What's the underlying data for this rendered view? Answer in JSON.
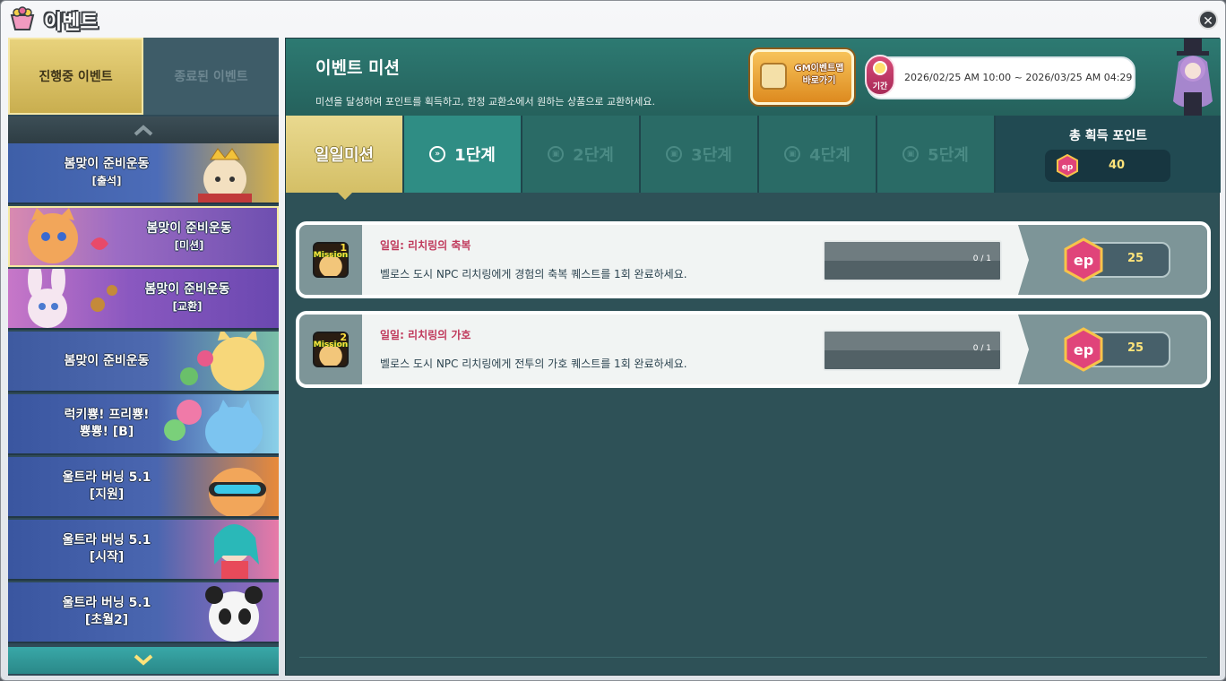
{
  "window": {
    "title": "이벤트",
    "close_label": "✕"
  },
  "sidebar": {
    "tabs": {
      "ongoing": "진행중 이벤트",
      "ended": "종료된 이벤트"
    },
    "items": [
      {
        "title": "봄맞이 준비운동",
        "sub": "[출석]"
      },
      {
        "title": "봄맞이 준비운동",
        "sub": "[미션]",
        "selected": true
      },
      {
        "title": "봄맞이 준비운동",
        "sub": "[교환]"
      },
      {
        "title": "봄맞이 준비운동",
        "sub": ""
      },
      {
        "title": "럭키뿅! 프리뿅!",
        "sub": "뿅뿅! [B]"
      },
      {
        "title": "울트라 버닝 5.1",
        "sub": "[지원]"
      },
      {
        "title": "울트라 버닝 5.1",
        "sub": "[시작]"
      },
      {
        "title": "울트라 버닝 5.1",
        "sub": "[초월2]"
      }
    ]
  },
  "header": {
    "title": "이벤트 미션",
    "description": "미션을 달성하여 포인트를 획득하고, 한정 교환소에서 원하는 상품으로 교환하세요.",
    "gm_button": {
      "line1": "GM이벤트맵",
      "line2": "바로가기"
    },
    "period": {
      "label": "기간",
      "text": "2026/02/25 AM 10:00 ~ 2026/03/25 AM 04:29"
    }
  },
  "stages": {
    "daily": "일일미션",
    "tabs": [
      "1단계",
      "2단계",
      "3단계",
      "4단계",
      "5단계"
    ],
    "active_index": 0
  },
  "points": {
    "title": "총 획득 포인트",
    "value": "40",
    "icon": "ep-coin-icon"
  },
  "missions": [
    {
      "badge": "Mission",
      "badge_num": "1",
      "title": "일일: 리치링의 축복",
      "description": "벨로스 도시 NPC 리치링에게 경험의 축복 퀘스트를 1회 완료하세요.",
      "progress_text": "0 / 1",
      "progress": 0,
      "reward_icon": "ep",
      "reward": "25"
    },
    {
      "badge": "Mission",
      "badge_num": "2",
      "title": "일일: 리치링의 가호",
      "description": "벨로스 도시 NPC 리치링에게 전투의 가호 퀘스트를 1회 완료하세요.",
      "progress_text": "0 / 1",
      "progress": 0,
      "reward_icon": "ep",
      "reward": "25"
    }
  ],
  "colors": {
    "accent_gold": "#d4bf66",
    "teal": "#2f8d84",
    "mission_title": "#c03a5c",
    "ep_pink": "#e0447a"
  }
}
